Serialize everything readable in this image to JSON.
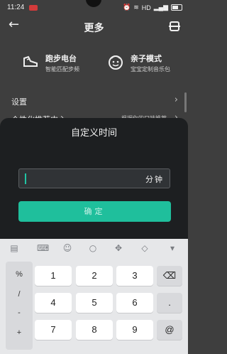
{
  "status_bar": {
    "time": "11:24",
    "net_label": "HD",
    "battery": ""
  },
  "header": {
    "title": "更多"
  },
  "cards": [
    {
      "title": "跑步电台",
      "subtitle": "智能匹配步频"
    },
    {
      "title": "亲子模式",
      "subtitle": "宝宝定制音乐包"
    }
  ],
  "rows": [
    {
      "label": "设置",
      "extra": ""
    },
    {
      "label": "个性化推荐中心",
      "extra": "根据你的口味推荐"
    }
  ],
  "dialog": {
    "title": "自定义时间",
    "input_value": "",
    "unit": "分钟",
    "confirm_label": "确定"
  },
  "keyboard": {
    "symbols": [
      "%",
      "/",
      "-",
      "+"
    ],
    "digits": [
      "1",
      "2",
      "3",
      "4",
      "5",
      "6",
      "7",
      "8",
      "9"
    ],
    "right_keys": [
      ".",
      "@"
    ],
    "toolbar_icons": [
      "clipboard-icon",
      "keyboard-icon",
      "emoji-icon",
      "search-icon",
      "cursor-move-icon",
      "clear-icon",
      "collapse-icon"
    ]
  }
}
